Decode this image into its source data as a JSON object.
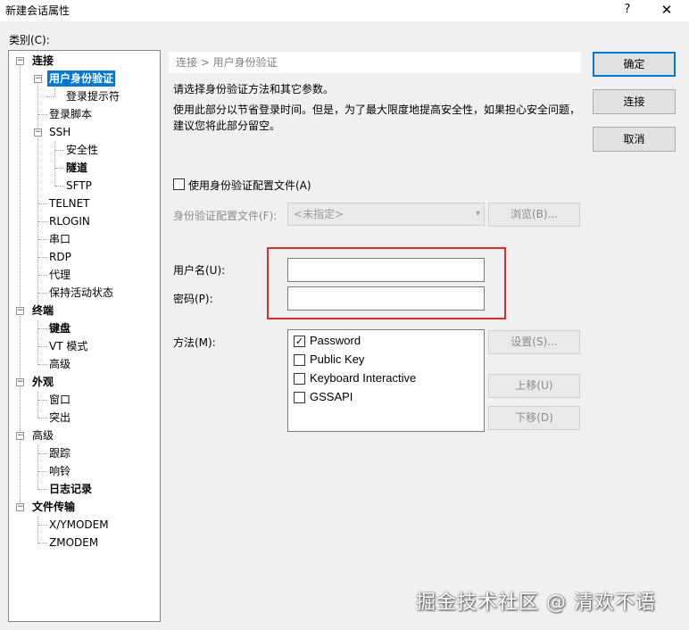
{
  "window": {
    "title": "新建会话属性",
    "help_glyph": "?",
    "close_glyph": "✕"
  },
  "category_label": "类别(C):",
  "tree": {
    "items": [
      {
        "label": "连接",
        "expander": "−"
      },
      {
        "label": "用户身份验证",
        "expander": "−"
      },
      {
        "label": "登录提示符"
      },
      {
        "label": "登录脚本"
      },
      {
        "label": "SSH",
        "expander": "−"
      },
      {
        "label": "安全性"
      },
      {
        "label": "隧道"
      },
      {
        "label": "SFTP"
      },
      {
        "label": "TELNET"
      },
      {
        "label": "RLOGIN"
      },
      {
        "label": "串口"
      },
      {
        "label": "RDP"
      },
      {
        "label": "代理"
      },
      {
        "label": "保持活动状态"
      },
      {
        "label": "终端",
        "expander": "−"
      },
      {
        "label": "键盘"
      },
      {
        "label": "VT 模式"
      },
      {
        "label": "高级"
      },
      {
        "label": "外观",
        "expander": "−"
      },
      {
        "label": "窗口"
      },
      {
        "label": "突出"
      },
      {
        "label": "高级",
        "expander": "−"
      },
      {
        "label": "跟踪"
      },
      {
        "label": "响铃"
      },
      {
        "label": "日志记录"
      },
      {
        "label": "文件传输",
        "expander": "−"
      },
      {
        "label": "X/YMODEM"
      },
      {
        "label": "ZMODEM"
      }
    ]
  },
  "panel": {
    "breadcrumb": "连接 > 用户身份验证",
    "intro": "请选择身份验证方法和其它参数。",
    "desc_line1": "使用此部分以节省登录时间。但是，为了最大限度地提高安全性，如果担心安全问题，",
    "desc_line2": "建议您将此部分留空。",
    "use_profile_label": "使用身份验证配置文件(A)",
    "profile_label": "身份验证配置文件(F):",
    "profile_select_value": "<未指定>",
    "select_arrow": "▾",
    "browse_button": "浏览(B)...",
    "username_label": "用户名(U):",
    "username_value": "",
    "password_label": "密码(P):",
    "password_value": "",
    "method_label": "方法(M):",
    "methods": [
      {
        "label": "Password",
        "mark": "✓"
      },
      {
        "label": "Public Key",
        "mark": ""
      },
      {
        "label": "Keyboard Interactive",
        "mark": ""
      },
      {
        "label": "GSSAPI",
        "mark": ""
      }
    ],
    "settings_button": "设置(S)...",
    "move_up_button": "上移(U)",
    "move_down_button": "下移(D)"
  },
  "buttons": {
    "ok": "确定",
    "connect": "连接",
    "cancel": "取消"
  },
  "watermark": "掘金技术社区 @ 清欢不语",
  "colors": {
    "selection": "#0078d7",
    "highlight_box": "#e02b2b"
  }
}
